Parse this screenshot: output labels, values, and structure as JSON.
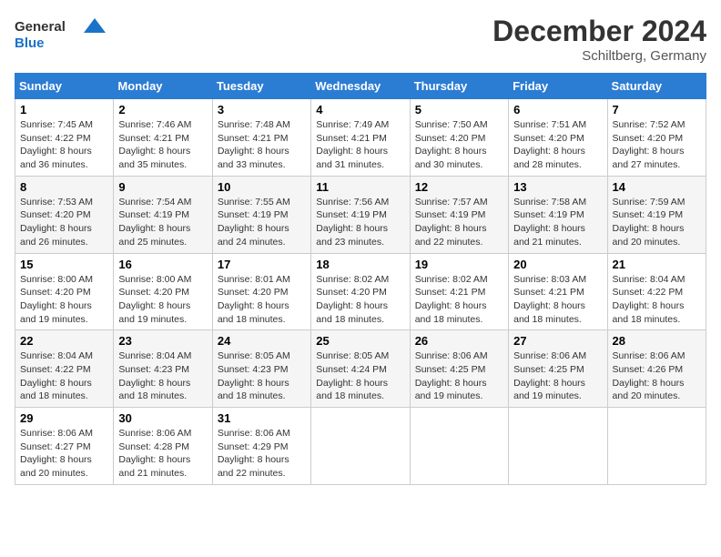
{
  "header": {
    "logo_line1": "General",
    "logo_line2": "Blue",
    "month_year": "December 2024",
    "location": "Schiltberg, Germany"
  },
  "weekdays": [
    "Sunday",
    "Monday",
    "Tuesday",
    "Wednesday",
    "Thursday",
    "Friday",
    "Saturday"
  ],
  "weeks": [
    [
      {
        "day": "1",
        "info": "Sunrise: 7:45 AM\nSunset: 4:22 PM\nDaylight: 8 hours and 36 minutes."
      },
      {
        "day": "2",
        "info": "Sunrise: 7:46 AM\nSunset: 4:21 PM\nDaylight: 8 hours and 35 minutes."
      },
      {
        "day": "3",
        "info": "Sunrise: 7:48 AM\nSunset: 4:21 PM\nDaylight: 8 hours and 33 minutes."
      },
      {
        "day": "4",
        "info": "Sunrise: 7:49 AM\nSunset: 4:21 PM\nDaylight: 8 hours and 31 minutes."
      },
      {
        "day": "5",
        "info": "Sunrise: 7:50 AM\nSunset: 4:20 PM\nDaylight: 8 hours and 30 minutes."
      },
      {
        "day": "6",
        "info": "Sunrise: 7:51 AM\nSunset: 4:20 PM\nDaylight: 8 hours and 28 minutes."
      },
      {
        "day": "7",
        "info": "Sunrise: 7:52 AM\nSunset: 4:20 PM\nDaylight: 8 hours and 27 minutes."
      }
    ],
    [
      {
        "day": "8",
        "info": "Sunrise: 7:53 AM\nSunset: 4:20 PM\nDaylight: 8 hours and 26 minutes."
      },
      {
        "day": "9",
        "info": "Sunrise: 7:54 AM\nSunset: 4:19 PM\nDaylight: 8 hours and 25 minutes."
      },
      {
        "day": "10",
        "info": "Sunrise: 7:55 AM\nSunset: 4:19 PM\nDaylight: 8 hours and 24 minutes."
      },
      {
        "day": "11",
        "info": "Sunrise: 7:56 AM\nSunset: 4:19 PM\nDaylight: 8 hours and 23 minutes."
      },
      {
        "day": "12",
        "info": "Sunrise: 7:57 AM\nSunset: 4:19 PM\nDaylight: 8 hours and 22 minutes."
      },
      {
        "day": "13",
        "info": "Sunrise: 7:58 AM\nSunset: 4:19 PM\nDaylight: 8 hours and 21 minutes."
      },
      {
        "day": "14",
        "info": "Sunrise: 7:59 AM\nSunset: 4:19 PM\nDaylight: 8 hours and 20 minutes."
      }
    ],
    [
      {
        "day": "15",
        "info": "Sunrise: 8:00 AM\nSunset: 4:20 PM\nDaylight: 8 hours and 19 minutes."
      },
      {
        "day": "16",
        "info": "Sunrise: 8:00 AM\nSunset: 4:20 PM\nDaylight: 8 hours and 19 minutes."
      },
      {
        "day": "17",
        "info": "Sunrise: 8:01 AM\nSunset: 4:20 PM\nDaylight: 8 hours and 18 minutes."
      },
      {
        "day": "18",
        "info": "Sunrise: 8:02 AM\nSunset: 4:20 PM\nDaylight: 8 hours and 18 minutes."
      },
      {
        "day": "19",
        "info": "Sunrise: 8:02 AM\nSunset: 4:21 PM\nDaylight: 8 hours and 18 minutes."
      },
      {
        "day": "20",
        "info": "Sunrise: 8:03 AM\nSunset: 4:21 PM\nDaylight: 8 hours and 18 minutes."
      },
      {
        "day": "21",
        "info": "Sunrise: 8:04 AM\nSunset: 4:22 PM\nDaylight: 8 hours and 18 minutes."
      }
    ],
    [
      {
        "day": "22",
        "info": "Sunrise: 8:04 AM\nSunset: 4:22 PM\nDaylight: 8 hours and 18 minutes."
      },
      {
        "day": "23",
        "info": "Sunrise: 8:04 AM\nSunset: 4:23 PM\nDaylight: 8 hours and 18 minutes."
      },
      {
        "day": "24",
        "info": "Sunrise: 8:05 AM\nSunset: 4:23 PM\nDaylight: 8 hours and 18 minutes."
      },
      {
        "day": "25",
        "info": "Sunrise: 8:05 AM\nSunset: 4:24 PM\nDaylight: 8 hours and 18 minutes."
      },
      {
        "day": "26",
        "info": "Sunrise: 8:06 AM\nSunset: 4:25 PM\nDaylight: 8 hours and 19 minutes."
      },
      {
        "day": "27",
        "info": "Sunrise: 8:06 AM\nSunset: 4:25 PM\nDaylight: 8 hours and 19 minutes."
      },
      {
        "day": "28",
        "info": "Sunrise: 8:06 AM\nSunset: 4:26 PM\nDaylight: 8 hours and 20 minutes."
      }
    ],
    [
      {
        "day": "29",
        "info": "Sunrise: 8:06 AM\nSunset: 4:27 PM\nDaylight: 8 hours and 20 minutes."
      },
      {
        "day": "30",
        "info": "Sunrise: 8:06 AM\nSunset: 4:28 PM\nDaylight: 8 hours and 21 minutes."
      },
      {
        "day": "31",
        "info": "Sunrise: 8:06 AM\nSunset: 4:29 PM\nDaylight: 8 hours and 22 minutes."
      },
      null,
      null,
      null,
      null
    ]
  ]
}
